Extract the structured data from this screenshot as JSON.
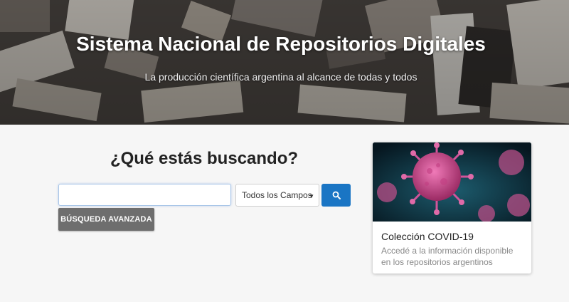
{
  "hero": {
    "title": "Sistema Nacional de Repositorios Digitales",
    "subtitle": "La producción científica argentina al alcance de todas y todos"
  },
  "search": {
    "heading": "¿Qué estás buscando?",
    "input_value": "",
    "input_placeholder": "",
    "field_selected": "Todos los Campos",
    "advanced_label": "BÚSQUEDA AVANZADA",
    "button_icon": "search-icon",
    "accent_color": "#1a75c4"
  },
  "card": {
    "title": "Colección COVID-19",
    "text": "Accedé a la información disponible en los repositorios argentinos",
    "image_icon": "virus-illustration"
  }
}
